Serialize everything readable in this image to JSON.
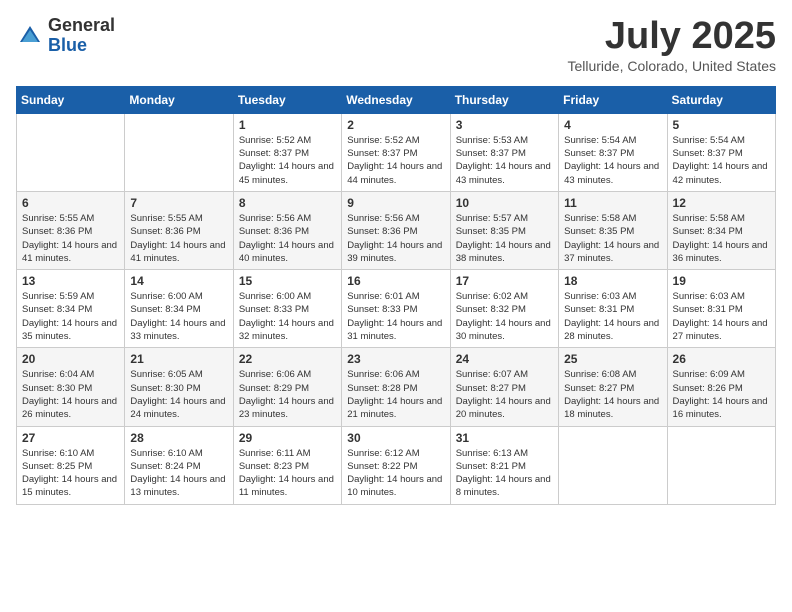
{
  "header": {
    "logo_general": "General",
    "logo_blue": "Blue",
    "month_year": "July 2025",
    "location": "Telluride, Colorado, United States"
  },
  "days_of_week": [
    "Sunday",
    "Monday",
    "Tuesday",
    "Wednesday",
    "Thursday",
    "Friday",
    "Saturday"
  ],
  "weeks": [
    [
      {
        "day": "",
        "sunrise": "",
        "sunset": "",
        "daylight": ""
      },
      {
        "day": "",
        "sunrise": "",
        "sunset": "",
        "daylight": ""
      },
      {
        "day": "1",
        "sunrise": "Sunrise: 5:52 AM",
        "sunset": "Sunset: 8:37 PM",
        "daylight": "Daylight: 14 hours and 45 minutes."
      },
      {
        "day": "2",
        "sunrise": "Sunrise: 5:52 AM",
        "sunset": "Sunset: 8:37 PM",
        "daylight": "Daylight: 14 hours and 44 minutes."
      },
      {
        "day": "3",
        "sunrise": "Sunrise: 5:53 AM",
        "sunset": "Sunset: 8:37 PM",
        "daylight": "Daylight: 14 hours and 43 minutes."
      },
      {
        "day": "4",
        "sunrise": "Sunrise: 5:54 AM",
        "sunset": "Sunset: 8:37 PM",
        "daylight": "Daylight: 14 hours and 43 minutes."
      },
      {
        "day": "5",
        "sunrise": "Sunrise: 5:54 AM",
        "sunset": "Sunset: 8:37 PM",
        "daylight": "Daylight: 14 hours and 42 minutes."
      }
    ],
    [
      {
        "day": "6",
        "sunrise": "Sunrise: 5:55 AM",
        "sunset": "Sunset: 8:36 PM",
        "daylight": "Daylight: 14 hours and 41 minutes."
      },
      {
        "day": "7",
        "sunrise": "Sunrise: 5:55 AM",
        "sunset": "Sunset: 8:36 PM",
        "daylight": "Daylight: 14 hours and 41 minutes."
      },
      {
        "day": "8",
        "sunrise": "Sunrise: 5:56 AM",
        "sunset": "Sunset: 8:36 PM",
        "daylight": "Daylight: 14 hours and 40 minutes."
      },
      {
        "day": "9",
        "sunrise": "Sunrise: 5:56 AM",
        "sunset": "Sunset: 8:36 PM",
        "daylight": "Daylight: 14 hours and 39 minutes."
      },
      {
        "day": "10",
        "sunrise": "Sunrise: 5:57 AM",
        "sunset": "Sunset: 8:35 PM",
        "daylight": "Daylight: 14 hours and 38 minutes."
      },
      {
        "day": "11",
        "sunrise": "Sunrise: 5:58 AM",
        "sunset": "Sunset: 8:35 PM",
        "daylight": "Daylight: 14 hours and 37 minutes."
      },
      {
        "day": "12",
        "sunrise": "Sunrise: 5:58 AM",
        "sunset": "Sunset: 8:34 PM",
        "daylight": "Daylight: 14 hours and 36 minutes."
      }
    ],
    [
      {
        "day": "13",
        "sunrise": "Sunrise: 5:59 AM",
        "sunset": "Sunset: 8:34 PM",
        "daylight": "Daylight: 14 hours and 35 minutes."
      },
      {
        "day": "14",
        "sunrise": "Sunrise: 6:00 AM",
        "sunset": "Sunset: 8:34 PM",
        "daylight": "Daylight: 14 hours and 33 minutes."
      },
      {
        "day": "15",
        "sunrise": "Sunrise: 6:00 AM",
        "sunset": "Sunset: 8:33 PM",
        "daylight": "Daylight: 14 hours and 32 minutes."
      },
      {
        "day": "16",
        "sunrise": "Sunrise: 6:01 AM",
        "sunset": "Sunset: 8:33 PM",
        "daylight": "Daylight: 14 hours and 31 minutes."
      },
      {
        "day": "17",
        "sunrise": "Sunrise: 6:02 AM",
        "sunset": "Sunset: 8:32 PM",
        "daylight": "Daylight: 14 hours and 30 minutes."
      },
      {
        "day": "18",
        "sunrise": "Sunrise: 6:03 AM",
        "sunset": "Sunset: 8:31 PM",
        "daylight": "Daylight: 14 hours and 28 minutes."
      },
      {
        "day": "19",
        "sunrise": "Sunrise: 6:03 AM",
        "sunset": "Sunset: 8:31 PM",
        "daylight": "Daylight: 14 hours and 27 minutes."
      }
    ],
    [
      {
        "day": "20",
        "sunrise": "Sunrise: 6:04 AM",
        "sunset": "Sunset: 8:30 PM",
        "daylight": "Daylight: 14 hours and 26 minutes."
      },
      {
        "day": "21",
        "sunrise": "Sunrise: 6:05 AM",
        "sunset": "Sunset: 8:30 PM",
        "daylight": "Daylight: 14 hours and 24 minutes."
      },
      {
        "day": "22",
        "sunrise": "Sunrise: 6:06 AM",
        "sunset": "Sunset: 8:29 PM",
        "daylight": "Daylight: 14 hours and 23 minutes."
      },
      {
        "day": "23",
        "sunrise": "Sunrise: 6:06 AM",
        "sunset": "Sunset: 8:28 PM",
        "daylight": "Daylight: 14 hours and 21 minutes."
      },
      {
        "day": "24",
        "sunrise": "Sunrise: 6:07 AM",
        "sunset": "Sunset: 8:27 PM",
        "daylight": "Daylight: 14 hours and 20 minutes."
      },
      {
        "day": "25",
        "sunrise": "Sunrise: 6:08 AM",
        "sunset": "Sunset: 8:27 PM",
        "daylight": "Daylight: 14 hours and 18 minutes."
      },
      {
        "day": "26",
        "sunrise": "Sunrise: 6:09 AM",
        "sunset": "Sunset: 8:26 PM",
        "daylight": "Daylight: 14 hours and 16 minutes."
      }
    ],
    [
      {
        "day": "27",
        "sunrise": "Sunrise: 6:10 AM",
        "sunset": "Sunset: 8:25 PM",
        "daylight": "Daylight: 14 hours and 15 minutes."
      },
      {
        "day": "28",
        "sunrise": "Sunrise: 6:10 AM",
        "sunset": "Sunset: 8:24 PM",
        "daylight": "Daylight: 14 hours and 13 minutes."
      },
      {
        "day": "29",
        "sunrise": "Sunrise: 6:11 AM",
        "sunset": "Sunset: 8:23 PM",
        "daylight": "Daylight: 14 hours and 11 minutes."
      },
      {
        "day": "30",
        "sunrise": "Sunrise: 6:12 AM",
        "sunset": "Sunset: 8:22 PM",
        "daylight": "Daylight: 14 hours and 10 minutes."
      },
      {
        "day": "31",
        "sunrise": "Sunrise: 6:13 AM",
        "sunset": "Sunset: 8:21 PM",
        "daylight": "Daylight: 14 hours and 8 minutes."
      },
      {
        "day": "",
        "sunrise": "",
        "sunset": "",
        "daylight": ""
      },
      {
        "day": "",
        "sunrise": "",
        "sunset": "",
        "daylight": ""
      }
    ]
  ]
}
